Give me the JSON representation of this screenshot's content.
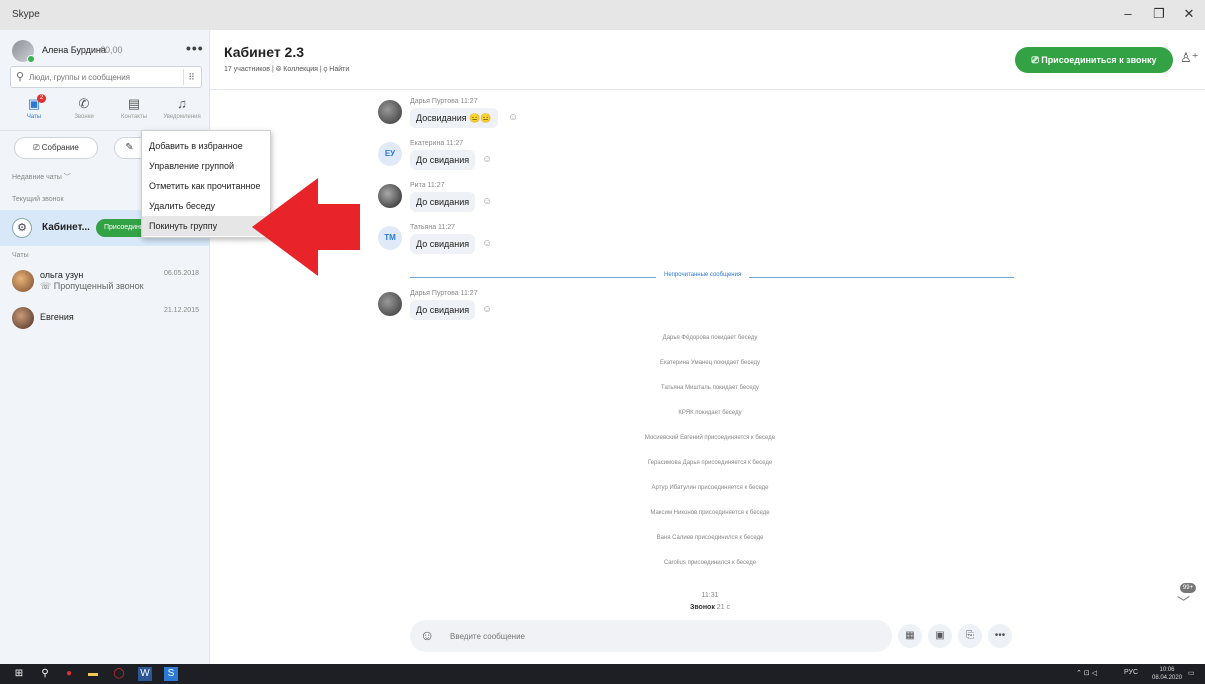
{
  "window": {
    "title": "Skype",
    "minimize": "–",
    "maximize": "❐",
    "close": "✕"
  },
  "profile": {
    "name": "Алена Бурдина",
    "credit": "€0,00",
    "more": "•••"
  },
  "search": {
    "placeholder": "Люди, группы и сообщения",
    "dial": "⠿"
  },
  "nav": [
    {
      "label": "Чаты",
      "icon": "chat-icon",
      "badge": "2"
    },
    {
      "label": "Звонки",
      "icon": "phone-icon"
    },
    {
      "label": "Контакты",
      "icon": "contacts-icon"
    },
    {
      "label": "Уведомления",
      "icon": "bell-icon"
    }
  ],
  "sidebar": {
    "meeting_label": "Собрание",
    "recent_label": "Недавние чаты ﹀",
    "current_call_label": "Текущий звонок",
    "current_call": {
      "name": "Кабинет...",
      "join": "Присоединиться"
    },
    "chats_label": "Чаты",
    "chats": [
      {
        "name": "ольга узун",
        "sub": "☏ Пропущенный звонок",
        "date": "06.05.2018"
      },
      {
        "name": "Евгения",
        "sub": "",
        "date": "21.12.2015"
      }
    ]
  },
  "context_menu": [
    "Добавить в избранное",
    "Управление группой",
    "Отметить как прочитанное",
    "Удалить беседу",
    "Покинуть группу"
  ],
  "header": {
    "title": "Кабинет 2.3",
    "meta": "17 участников | ⦾ Коллекция | ⚲ Найти",
    "join_call": "Присоединиться к звонку",
    "add_person": "♙⁺"
  },
  "messages": [
    {
      "author": "Дарья Пуртова 11:27",
      "text": "Досвидания 😑😑",
      "initials": "",
      "avatar_color": "#555"
    },
    {
      "author": "Екатерина 11:27",
      "text": "До свидания",
      "initials": "ЕУ",
      "avatar_color": "#dfe9f7"
    },
    {
      "author": "Рита 11:27",
      "text": "До свидания",
      "initials": "",
      "avatar_color": "#555"
    },
    {
      "author": "Татьяна 11:27",
      "text": "До свидания",
      "initials": "ТМ",
      "avatar_color": "#dfe9f7"
    }
  ],
  "unread_label": "Непрочитанные сообщения",
  "unread_message": {
    "author": "Дарья Пуртова 11:27",
    "text": "До свидания"
  },
  "system_messages": [
    "Дарья Фёдорова покидает беседу",
    "Екатерина Уманец покидает беседу",
    "Татьяна Мишталь покидает беседу",
    "КРЯК покидает беседу",
    "Мосиевский Евгений присоединяется к беседе",
    "Герасимова Дарья присоединяется к беседе",
    "Артур Ибатулин присоединяется к беседе",
    "Максим Никонов присоединяется к беседе",
    "Ваня Салиев присоединился к беседе",
    "Carolius присоединился к беседе"
  ],
  "call_event": {
    "time": "11:31",
    "label": "Звонок",
    "duration": "21 с"
  },
  "scroll_badge": "99+",
  "composer": {
    "placeholder": "Введите сообщение"
  },
  "taskbar": {
    "lang": "РУС",
    "time": "10:06",
    "date": "08.04.2020"
  }
}
